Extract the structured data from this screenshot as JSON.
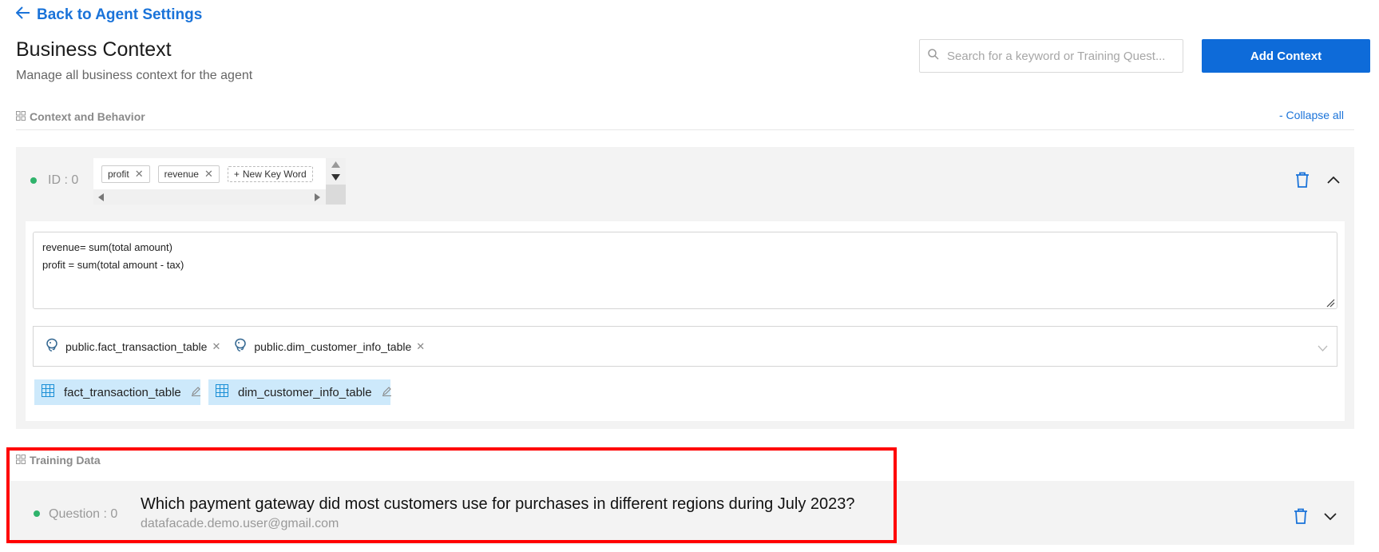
{
  "header": {
    "back_label": "Back to Agent Settings",
    "title": "Business Context",
    "subtitle": "Manage all business context for the agent",
    "search_placeholder": "Search for a keyword or Training Quest...",
    "add_button_label": "Add Context"
  },
  "context_section": {
    "title": "Context and Behavior",
    "collapse_label": "- Collapse all",
    "item": {
      "id_label": "ID : 0",
      "keywords": [
        "profit",
        "revenue"
      ],
      "new_keyword_label": "New Key Word",
      "definition": "revenue= sum(total amount)\nprofit = sum(total amount - tax)",
      "selected_tables": [
        "public.fact_transaction_table",
        "public.dim_customer_info_table"
      ],
      "table_chips": [
        "fact_transaction_table",
        "dim_customer_info_table"
      ]
    }
  },
  "training_section": {
    "title": "Training Data",
    "item": {
      "label": "Question : 0",
      "question": "Which payment gateway did most customers use for purchases in different regions during July 2023?",
      "email": "datafacade.demo.user@gmail.com"
    }
  },
  "colors": {
    "accent": "#1a73d9",
    "primary_button": "#0e6bd9",
    "status_dot": "#2fb36b",
    "chip_bg": "#cde9fb",
    "highlight": "#ff0000"
  },
  "icons": [
    "arrow-left-icon",
    "search-icon",
    "grid-icon",
    "close-icon",
    "plus-icon",
    "postgres-icon",
    "table-icon",
    "edit-icon",
    "trash-icon",
    "chevron-up-icon",
    "chevron-down-icon"
  ]
}
